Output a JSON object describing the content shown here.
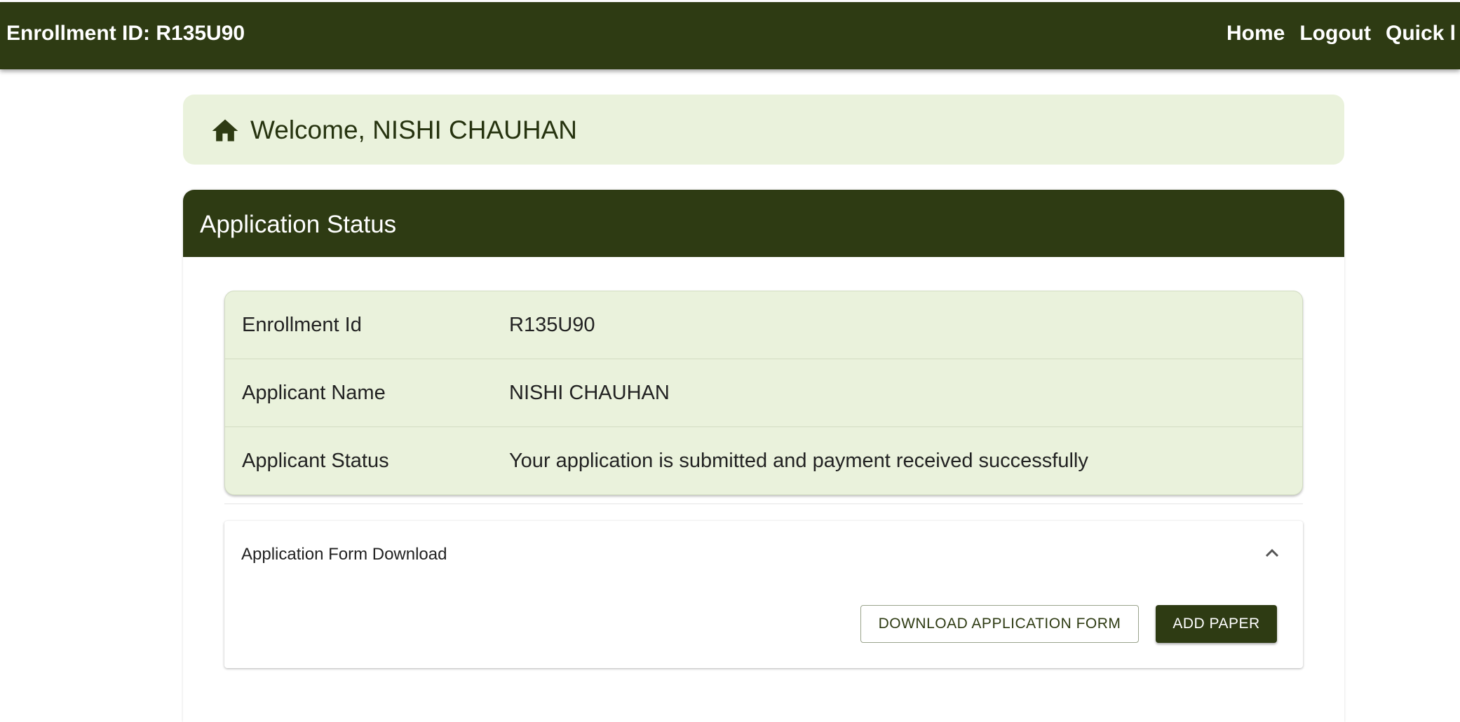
{
  "topbar": {
    "title": "Enrollment ID: R135U90",
    "nav": {
      "home": "Home",
      "logout": "Logout",
      "quick": "Quick l"
    }
  },
  "welcome": {
    "icon": "home-icon",
    "text": "Welcome, NISHI CHAUHAN"
  },
  "status_card": {
    "title": "Application Status",
    "rows": [
      {
        "label": "Enrollment Id",
        "value": "R135U90"
      },
      {
        "label": "Applicant Name",
        "value": "NISHI CHAUHAN"
      },
      {
        "label": "Applicant Status",
        "value": "Your application is submitted and payment received successfully"
      }
    ]
  },
  "download_section": {
    "title": "Application Form Download",
    "expand_icon": "chevron-up-icon",
    "download_button": "DOWNLOAD APPLICATION FORM",
    "add_paper_button": "ADD PAPER"
  },
  "colors": {
    "primary": "#2e3b13",
    "panel_bg": "#eaf2dc"
  }
}
